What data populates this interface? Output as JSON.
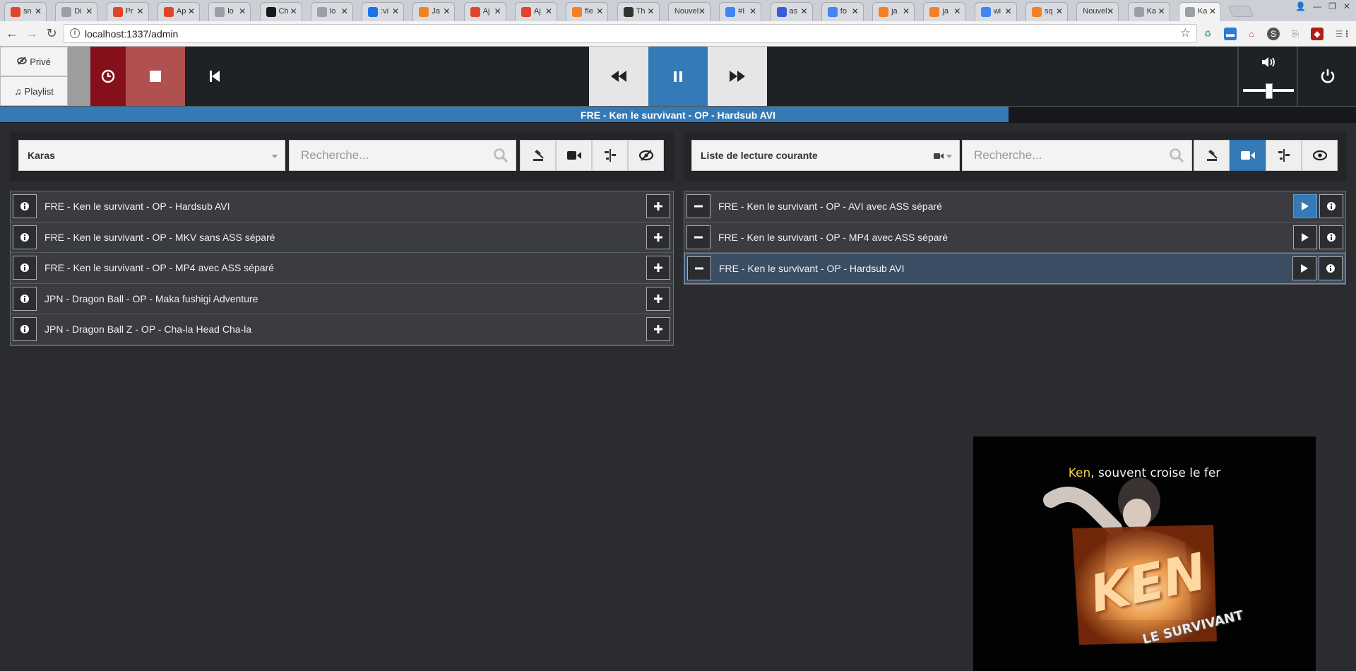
{
  "browser": {
    "tabs": [
      {
        "title": "sn",
        "color": "#e24329"
      },
      {
        "title": "Di",
        "color": "#9aa0a6"
      },
      {
        "title": "Pr",
        "color": "#e24329"
      },
      {
        "title": "Ap",
        "color": "#e24329"
      },
      {
        "title": "lo",
        "color": "#9aa0a6"
      },
      {
        "title": "Ch",
        "color": "#181717"
      },
      {
        "title": "lo",
        "color": "#9aa0a6"
      },
      {
        "title": ":vi",
        "color": "#1a73e8"
      },
      {
        "title": "Ja",
        "color": "#f48024"
      },
      {
        "title": "Aj",
        "color": "#e24329"
      },
      {
        "title": "Aj",
        "color": "#e24329"
      },
      {
        "title": "fle",
        "color": "#f48024"
      },
      {
        "title": "Th",
        "color": "#333333"
      },
      {
        "title": "Nouvel",
        "color": ""
      },
      {
        "title": "#I",
        "color": "#4285f4"
      },
      {
        "title": "as",
        "color": "#3b5bdb"
      },
      {
        "title": "fo",
        "color": "#4285f4"
      },
      {
        "title": "ja",
        "color": "#f48024"
      },
      {
        "title": "ja",
        "color": "#f48024"
      },
      {
        "title": "wi",
        "color": "#4285f4"
      },
      {
        "title": "sq",
        "color": "#f48024"
      },
      {
        "title": "Nouvel",
        "color": ""
      },
      {
        "title": "Ka",
        "color": "#9aa0a6"
      },
      {
        "title": "Ka",
        "color": "#9aa0a6"
      }
    ],
    "url": "localhost:1337/admin"
  },
  "header": {
    "private_label": "Privé",
    "playlist_label": "Playlist"
  },
  "now_playing": {
    "title": "FRE - Ken le survivant - OP - Hardsub AVI",
    "progress": 0.744
  },
  "left_panel": {
    "select_label": "Karas",
    "search_placeholder": "Recherche...",
    "items": [
      "FRE - Ken le survivant - OP - Hardsub AVI",
      "FRE - Ken le survivant - OP - MKV sans ASS séparé",
      "FRE - Ken le survivant - OP - MP4 avec ASS séparé",
      "JPN - Dragon Ball - OP - Maka fushigi Adventure",
      "JPN - Dragon Ball Z - OP - Cha-la Head Cha-la"
    ]
  },
  "right_panel": {
    "select_label": "Liste de lecture courante",
    "search_placeholder": "Recherche...",
    "items": [
      "FRE - Ken le survivant - OP - AVI avec ASS séparé",
      "FRE - Ken le survivant - OP - MP4 avec ASS séparé",
      "FRE - Ken le survivant - OP - Hardsub AVI"
    ]
  },
  "video": {
    "subtitle_highlight": "Ken",
    "subtitle_rest": ", souvent croise le fer",
    "logo_text": "KEN",
    "logo_sub": "LE SURVIVANT"
  },
  "colors": {
    "accent": "#337ab7",
    "stop": "#b0514f",
    "timer": "#860f1c"
  }
}
